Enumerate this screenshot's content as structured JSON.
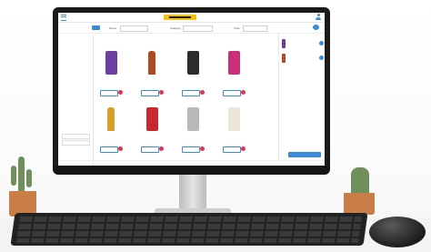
{
  "colors": {
    "accent": "#3a8bd8",
    "heart": "#e0344f",
    "logo": "#f4c20d"
  },
  "header": {
    "menu_icon": "hamburger-icon",
    "logo": "brand-logo",
    "user_icon": "user-icon"
  },
  "filters": {
    "home_label": "",
    "label_1": "Name",
    "select_1": "",
    "label_2": "Category",
    "select_2": "",
    "label_3": "Price",
    "select_3": "",
    "cart_icon": "cart-icon"
  },
  "sidebar": {
    "sections": [
      "",
      "",
      ""
    ],
    "items": [
      "",
      "",
      "",
      "",
      "",
      "",
      "",
      "",
      "",
      "",
      ""
    ]
  },
  "products": [
    {
      "color": "#6a3fa0",
      "shape": "can"
    },
    {
      "color": "#b04a20",
      "shape": "bottle"
    },
    {
      "color": "#2c2c2c",
      "shape": "can"
    },
    {
      "color": "#cc2f7a",
      "shape": "can"
    },
    {
      "color": "#d4a02a",
      "shape": "bottle"
    },
    {
      "color": "#c8282e",
      "shape": "can"
    },
    {
      "color": "#b8b8b8",
      "shape": "can"
    },
    {
      "color": "#ece6d8",
      "shape": "can"
    }
  ],
  "cart_panel": {
    "items": [
      {
        "color": "#6a3fa0"
      },
      {
        "color": "#b04a20"
      }
    ],
    "checkout_label": ""
  }
}
